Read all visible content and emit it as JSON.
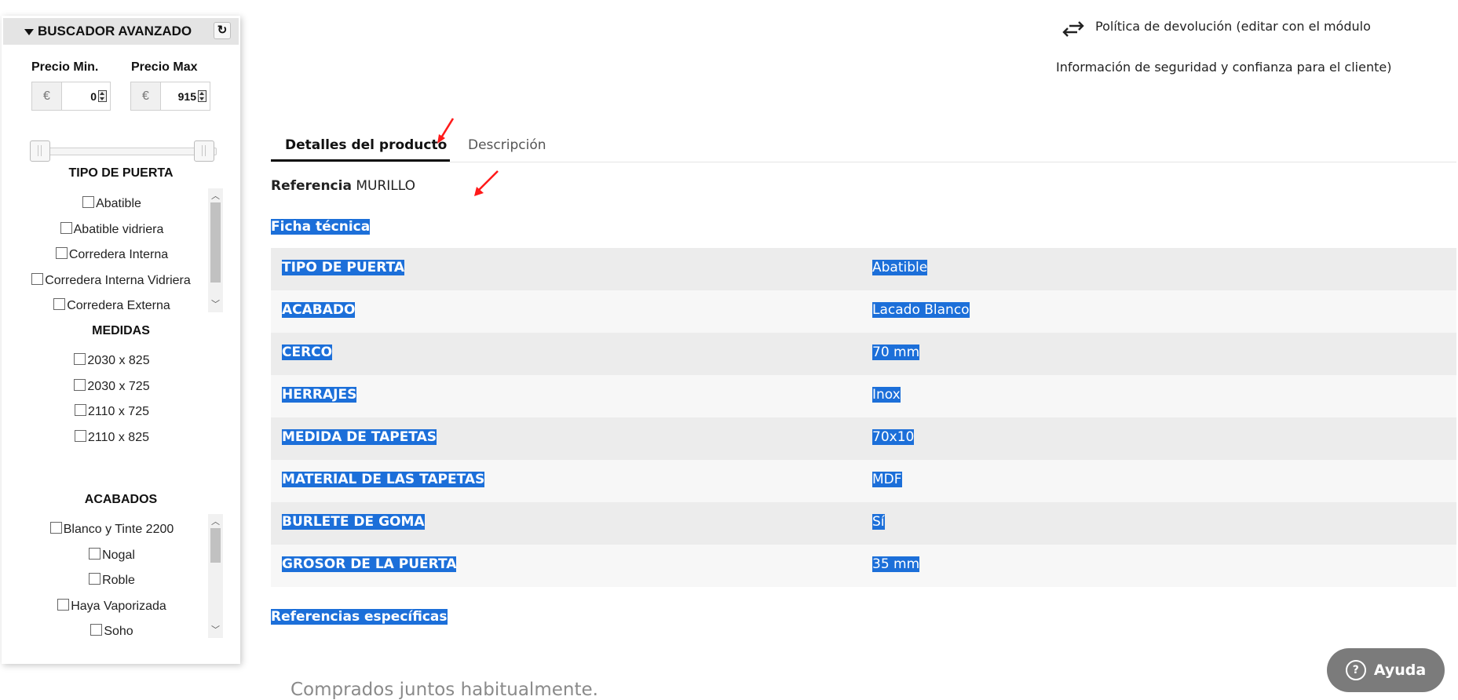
{
  "sidebar": {
    "title": "BUSCADOR AVANZADO",
    "refresh_glyph": "↻",
    "price_min_label": "Precio Min.",
    "price_max_label": "Precio Max",
    "currency": "€",
    "price_min_value": "0",
    "price_max_value": "915",
    "tipo_title": "TIPO DE PUERTA",
    "tipo_items": [
      "Abatible",
      "Abatible vidriera",
      "Corredera Interna",
      "Corredera Interna Vidriera",
      "Corredera Externa"
    ],
    "medidas_title": "MEDIDAS",
    "medidas_items": [
      "2030 x 825",
      "2030 x 725",
      "2110 x 725",
      "2110 x 825"
    ],
    "acabados_title": "ACABADOS",
    "acabados_items": [
      "Blanco y Tinte 2200",
      "Nogal",
      "Roble",
      "Haya Vaporizada",
      "Soho"
    ]
  },
  "header": {
    "policy_text": "Política de devolución (editar con el módulo",
    "info_text": "Información de seguridad y confianza para el cliente)"
  },
  "tabs": [
    "Detalles del producto",
    "Descripción"
  ],
  "product": {
    "ref_label": "Referencia",
    "ref_value": "MURILLO",
    "ficha_title": "Ficha técnica",
    "features": [
      {
        "k": "TIPO DE PUERTA",
        "v": "Abatible"
      },
      {
        "k": "ACABADO",
        "v": "Lacado Blanco"
      },
      {
        "k": "CERCO",
        "v": "70 mm"
      },
      {
        "k": "HERRAJES",
        "v": "Inox"
      },
      {
        "k": "MEDIDA DE TAPETAS",
        "v": "70x10"
      },
      {
        "k": "MATERIAL DE LAS TAPETAS",
        "v": "MDF"
      },
      {
        "k": "BURLETE DE GOMA",
        "v": "Sí"
      },
      {
        "k": "GROSOR DE LA PUERTA",
        "v": "35 mm"
      }
    ],
    "refs_title": "Referencias específicas"
  },
  "comprados": "Comprados juntos habitualmente.",
  "help": {
    "label": "Ayuda",
    "glyph": "?"
  },
  "colors": {
    "selection": "#1c6fd9",
    "annotation_arrow": "#ff1a1a"
  }
}
